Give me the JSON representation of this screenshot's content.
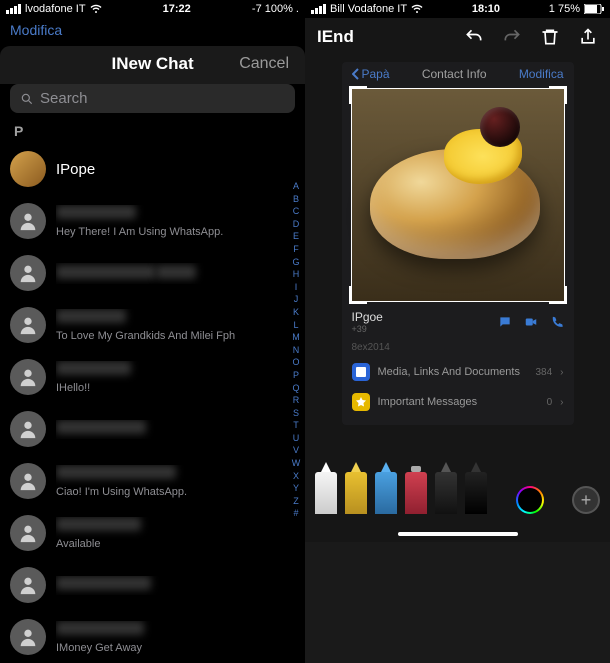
{
  "left": {
    "status": {
      "carrier": "lvodafone IT",
      "time": "17:22",
      "battery": "-7 100% ."
    },
    "hint": "Modifica",
    "sheet": {
      "title": "INew Chat",
      "cancel": "Cancel",
      "search": "Search"
    },
    "section": "P",
    "contacts": [
      {
        "name": "IPope",
        "status": "",
        "photo": true,
        "blurred": false
      },
      {
        "name": "████████",
        "status": "Hey There! I Am Using WhatsApp.",
        "blurred": true
      },
      {
        "name": "████████",
        "status": "████",
        "blurred": true
      },
      {
        "name": "████████",
        "status": "To Love My Grandkids And Milei Fph",
        "blurred": true
      },
      {
        "name": "████████",
        "status": "IHello!!",
        "blurred": true
      },
      {
        "name": "████████",
        "status": "",
        "blurred": true
      },
      {
        "name": "████████████",
        "status": "Ciao! I'm Using WhatsApp.",
        "blurred": true
      },
      {
        "name": "████████",
        "status": "Available",
        "blurred": true
      },
      {
        "name": "████████",
        "status": "",
        "blurred": true
      },
      {
        "name": "████████",
        "status": "IMoney Get Away",
        "blurred": true
      }
    ],
    "index": [
      "A",
      "B",
      "C",
      "D",
      "E",
      "F",
      "G",
      "H",
      "I",
      "J",
      "K",
      "L",
      "M",
      "N",
      "O",
      "P",
      "Q",
      "R",
      "S",
      "T",
      "U",
      "V",
      "W",
      "X",
      "Y",
      "Z",
      "#"
    ]
  },
  "right": {
    "status": {
      "carrier": "Bill Vodafone IT",
      "time": "18:10",
      "battery": "1 75%"
    },
    "toolbar": {
      "end": "IEnd"
    },
    "pf": {
      "back": "Papà",
      "title": "Contact Info",
      "edit": "Modifica"
    },
    "info": {
      "name": "IPgoe",
      "sub": "+39",
      "date": "8ex2014",
      "media": {
        "label": "Media, Links And Documents",
        "count": "384"
      },
      "important": {
        "label": "Important Messages",
        "count": "0"
      }
    }
  }
}
